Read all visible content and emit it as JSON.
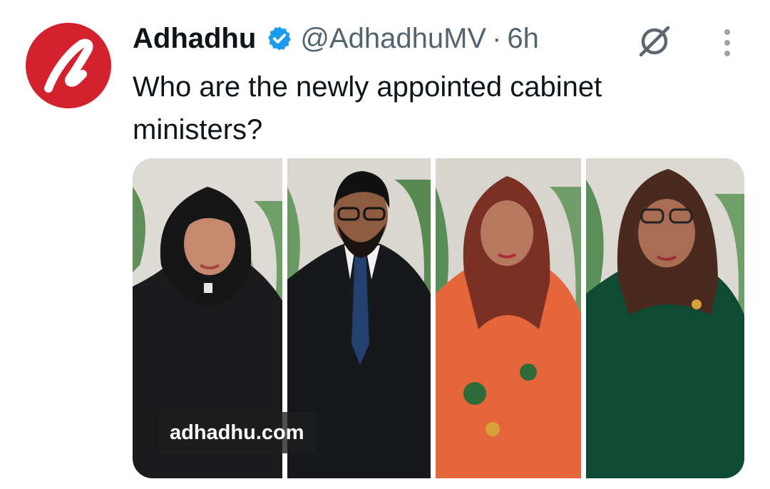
{
  "tweet": {
    "author_name": "Adhadhu",
    "handle": "@AdhadhuMV",
    "separator": "·",
    "time": "6h",
    "text": "Who are the newly appointed cabinet ministers?",
    "brand_color": "#d3212e",
    "verified_color": "#1d9bf0"
  },
  "media": {
    "watermark": "adhadhu.com",
    "photos": [
      {
        "subject": "minister-1",
        "attire_color": "#1b1b1d"
      },
      {
        "subject": "minister-2",
        "attire_color": "#16181c"
      },
      {
        "subject": "minister-3",
        "attire_color": "#e4663a"
      },
      {
        "subject": "minister-4",
        "attire_color": "#0f4a34"
      }
    ]
  },
  "icons": {
    "avatar": "adhadhu-logo-icon",
    "verified": "verified-badge-icon",
    "grok": "grok-icon",
    "more": "more-dots-icon"
  }
}
